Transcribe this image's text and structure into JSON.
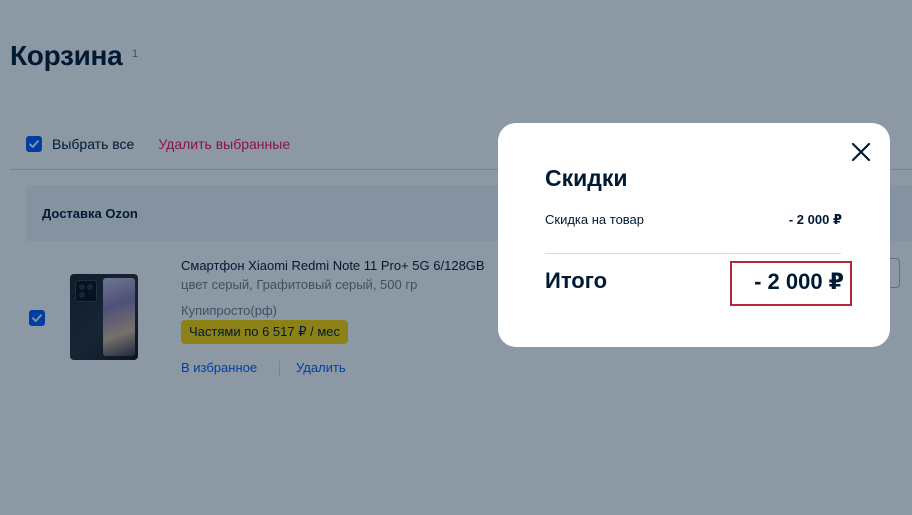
{
  "cart": {
    "title": "Корзина",
    "count": "1",
    "select_all_label": "Выбрать все",
    "delete_selected_label": "Удалить выбранные",
    "delivery_title": "Доставка Ozon"
  },
  "product": {
    "name": "Смартфон Xiaomi Redmi Note 11 Pro+ 5G 6/128GB",
    "attributes": "цвет серый, Графитовый серый, 500 гр",
    "seller": "Купипросто(рф)",
    "installment": "Частями по 6 517 ₽ / мес",
    "favorite_link": "В избранное",
    "remove_link": "Удалить",
    "checked": true
  },
  "modal": {
    "title": "Скидки",
    "discount_label": "Скидка на товар",
    "discount_value": "- 2 000 ₽",
    "total_label": "Итого",
    "total_value": "- 2 000 ₽"
  },
  "colors": {
    "accent": "#005bff",
    "danger": "#f91155",
    "installment_badge": "#ffd600",
    "highlight_border": "#b5263d",
    "text": "#001a34",
    "overlay": "rgba(0,26,52,0.45)"
  },
  "icons": {
    "checkbox": "check-icon",
    "close": "close-icon"
  }
}
